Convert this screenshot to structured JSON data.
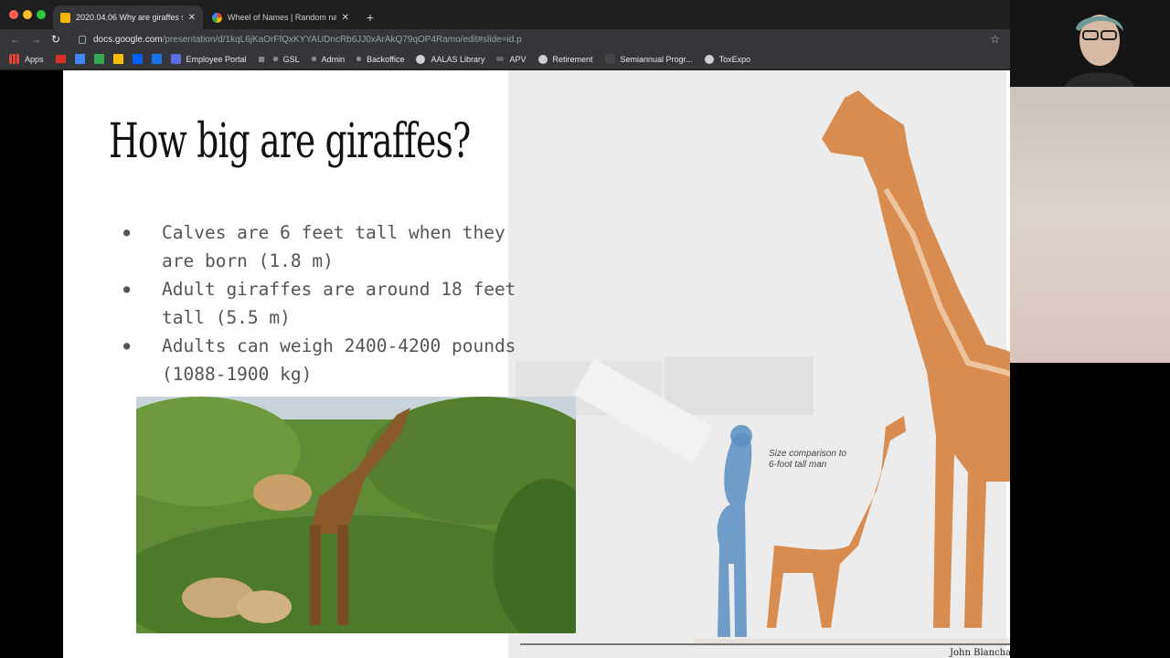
{
  "tabs": [
    {
      "title": "2020.04.06 Why are giraffes s",
      "active": true
    },
    {
      "title": "Wheel of Names | Random nar",
      "active": false
    }
  ],
  "new_tab": "+",
  "address": {
    "host": "docs.google.com",
    "path": "/presentation/d/1kqL6jKaOrFfQxKYYAUDncRb6JJ0xArAkQ79qOP4Ramo/edit#slide=id.p"
  },
  "bookmarks": [
    "Apps",
    "Employee Portal",
    "GSL",
    "Admin",
    "Backoffice",
    "AALAS Library",
    "APV",
    "Retirement",
    "Semiannual Progr...",
    "ToxExpo"
  ],
  "slide": {
    "title": "How big are giraffes?",
    "bullets": [
      "Calves are 6 feet tall when they are born (1.8 m)",
      "Adult giraffes are around 18 feet tall (5.5 m)",
      "Adults can weigh 2400-4200 pounds (1088-1900 kg)"
    ],
    "size_caption": "Size comparison to 6-foot tall man",
    "credit": "John Blanchard / The Chronicle"
  },
  "colors": {
    "giraffe": "#d98c4f",
    "human_silhouette": "#5b8fc1",
    "foliage": "#5f8a36"
  }
}
